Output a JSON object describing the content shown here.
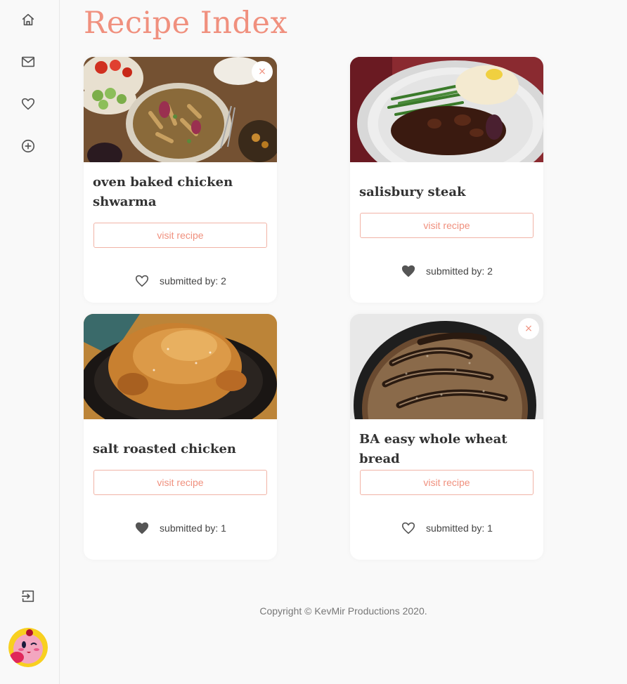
{
  "sidebar": {
    "icons": [
      "home-icon",
      "mail-icon",
      "heart-icon",
      "add-circle-icon",
      "logout-icon"
    ],
    "avatar": "kirby-avatar"
  },
  "page": {
    "title": "Recipe Index"
  },
  "recipes": [
    {
      "title": "oven baked chicken shwarma",
      "button_label": "visit recipe",
      "submitted_label": "submitted by: 2",
      "favorited": false,
      "deletable": true,
      "delete_label": "×"
    },
    {
      "title": "salisbury steak",
      "button_label": "visit recipe",
      "submitted_label": "submitted by: 2",
      "favorited": true,
      "deletable": false
    },
    {
      "title": "salt roasted chicken",
      "button_label": "visit recipe",
      "submitted_label": "submitted by: 1",
      "favorited": true,
      "deletable": false
    },
    {
      "title": "BA easy whole wheat bread",
      "button_label": "visit recipe",
      "submitted_label": "submitted by: 1",
      "favorited": false,
      "deletable": true,
      "delete_label": "×"
    }
  ],
  "footer": {
    "copyright": "Copyright © KevMir Productions 2020."
  },
  "colors": {
    "accent": "#f0907e",
    "background": "#f9f9f9",
    "heart_filled": "#555555"
  }
}
